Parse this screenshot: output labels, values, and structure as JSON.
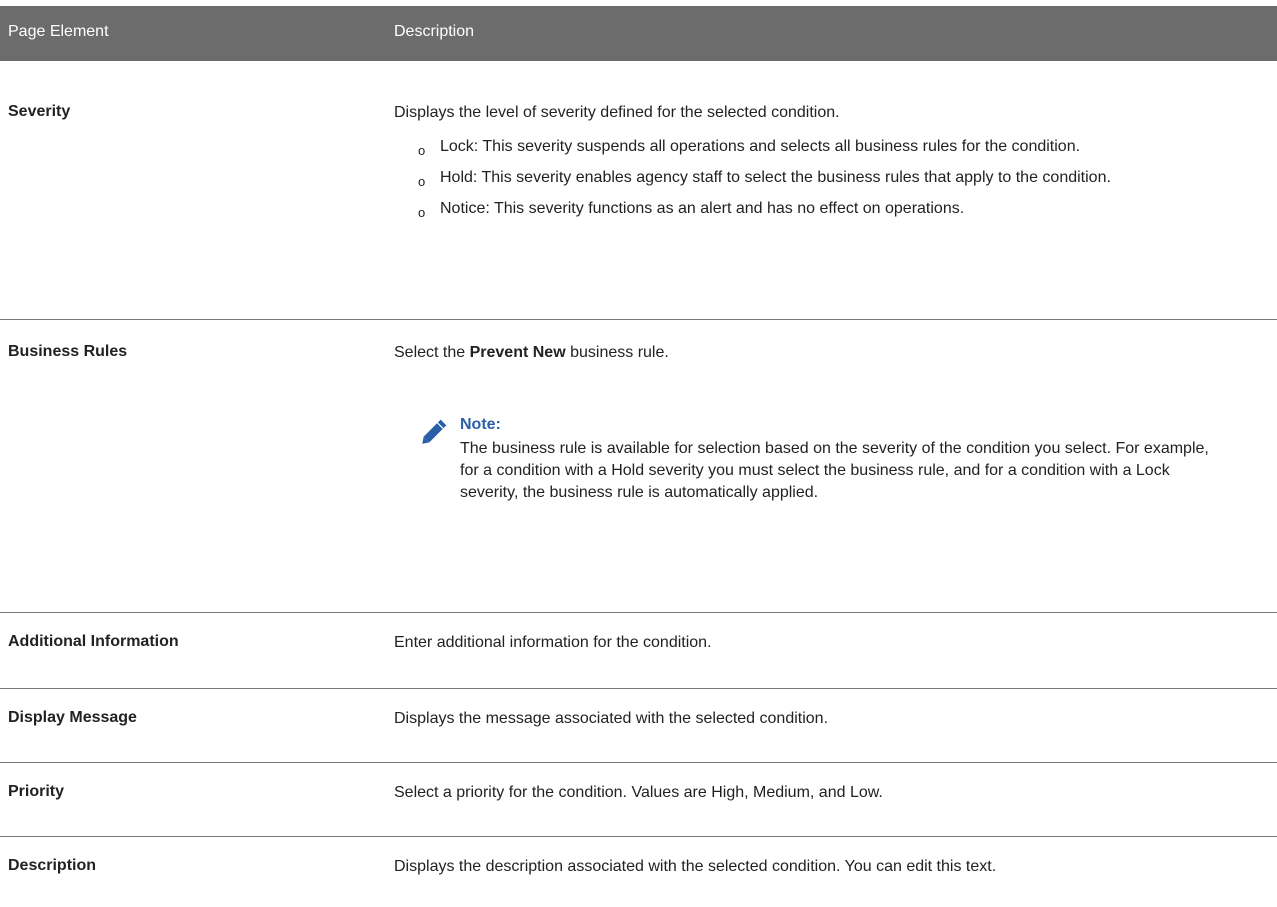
{
  "header": {
    "col1": "Page Element",
    "col2": "Description"
  },
  "rows": {
    "severity": {
      "label": "Severity",
      "desc": "Displays the level of severity defined for the selected condition.",
      "bullet_marker": "o",
      "bullets": [
        "Lock: This severity suspends all operations and selects all business rules for the condition.",
        "Hold: This severity enables agency staff to select the business rules that apply to the condition.",
        "Notice: This severity functions as an alert and has no effect on operations."
      ]
    },
    "business_rules": {
      "label": "Business Rules",
      "desc_prefix": "Select the ",
      "desc_bold": "Prevent New",
      "desc_suffix": " business rule.",
      "note_title": "Note:",
      "note_body": "The business rule is available for selection based on the severity of the condition you select. For example, for a condition with a Hold severity you must select the business rule, and for a condition with a Lock severity, the business rule is automatically applied."
    },
    "additional_info": {
      "label": "Additional Information",
      "desc": "Enter additional information for the condition."
    },
    "display_message": {
      "label": "Display Message",
      "desc": "Displays the message associated with the selected condition."
    },
    "priority": {
      "label": "Priority",
      "desc": "Select a priority for the condition. Values are High, Medium, and Low."
    },
    "description": {
      "label": "Description",
      "desc": "Displays the description associated with the selected condition. You can edit this text."
    }
  },
  "colors": {
    "header_bg": "#6c6c6c",
    "note_title": "#2a5fa8",
    "pencil_icon": "#2a5fa8"
  },
  "icons": {
    "note": "pencil-icon"
  }
}
